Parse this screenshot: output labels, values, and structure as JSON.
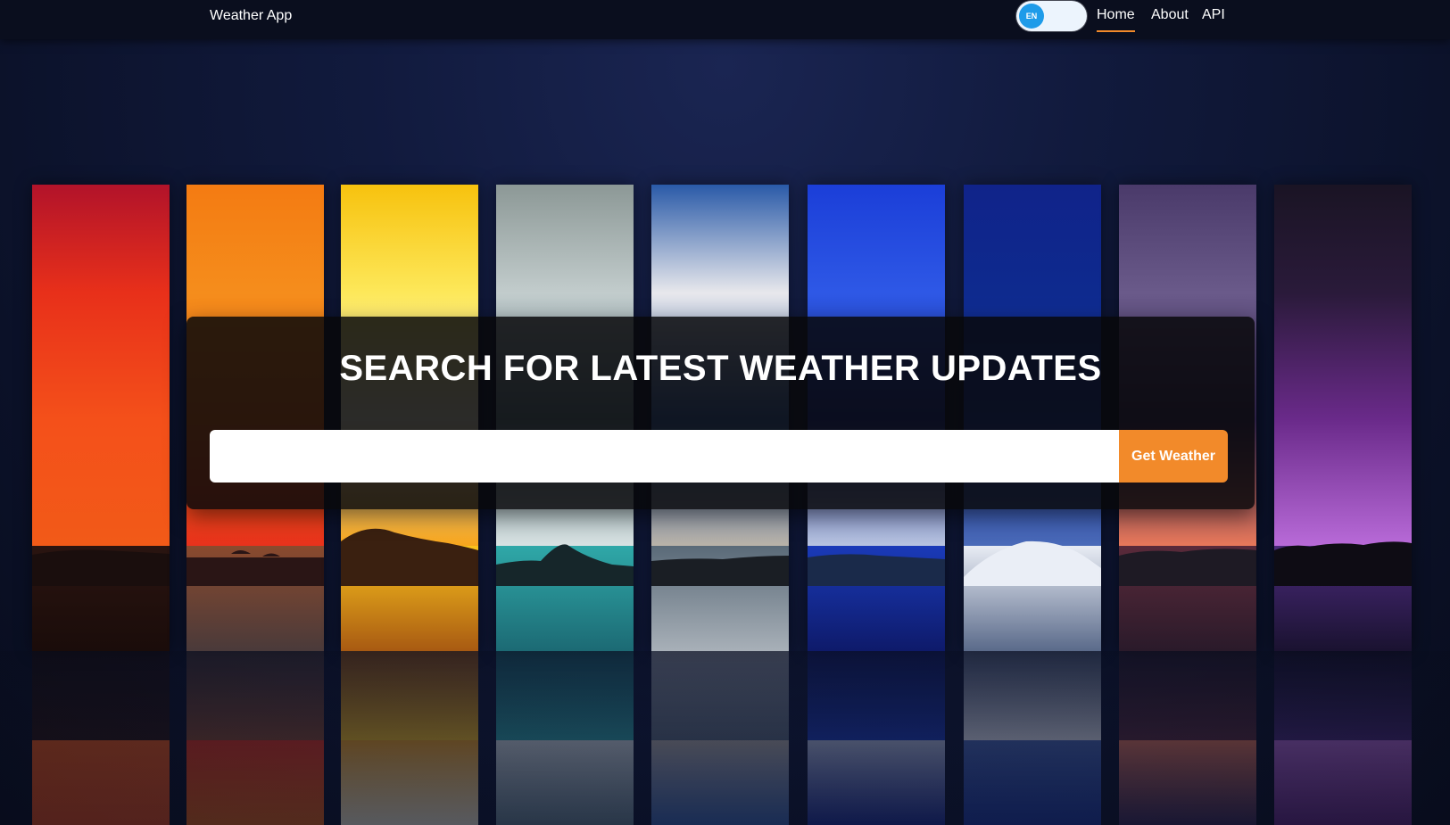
{
  "navbar": {
    "brand": "Weather App",
    "language_toggle_label": "EN",
    "links": [
      {
        "label": "Home",
        "active": true
      },
      {
        "label": "About",
        "active": false
      },
      {
        "label": "API",
        "active": false
      }
    ],
    "accent_color": "#f28a2a",
    "toggle_knob_color": "#1e9be9"
  },
  "hero": {
    "title": "SEARCH FOR LATEST WEATHER UPDATES",
    "search": {
      "value": "",
      "placeholder": "",
      "button_label": "Get Weather"
    },
    "button_color": "#f28a2a"
  },
  "background_panels": [
    {
      "name": "red-sunset",
      "sky": [
        "#b2132a",
        "#e8301a",
        "#f4501a",
        "#f25a18"
      ],
      "sea": [
        "#2a1410",
        "#1a0c0a"
      ],
      "land": "#1a0e0d"
    },
    {
      "name": "orange-sunset",
      "sky": [
        "#f47b12",
        "#f58d1c",
        "#f16a14",
        "#e8321c"
      ],
      "sea": [
        "#8a4a2e",
        "#4a3a3a"
      ],
      "land": "#2a1515"
    },
    {
      "name": "yellow-sun",
      "sky": [
        "#f7c20e",
        "#fde85a",
        "#fffbe0",
        "#f6a51c"
      ],
      "sea": [
        "#f9c21d",
        "#a85a12"
      ],
      "land": "#3a2010"
    },
    {
      "name": "cloudy-teal",
      "sky": [
        "#8c9896",
        "#c2cccc",
        "#6a8a96",
        "#d8e2e2"
      ],
      "sea": [
        "#2fa8a8",
        "#1c6a74"
      ],
      "land": "#16262a"
    },
    {
      "name": "blue-clouds",
      "sky": [
        "#2a5aa8",
        "#e8e8ec",
        "#3a6ab8",
        "#b8b2a8"
      ],
      "sea": [
        "#5a6a78",
        "#a8b0b8"
      ],
      "land": "#1a1e24"
    },
    {
      "name": "deep-blue",
      "sky": [
        "#1b3ed8",
        "#2e58e6",
        "#1a2e9a",
        "#b8c4e0"
      ],
      "sea": [
        "#1a3ab8",
        "#0e1a6a"
      ],
      "land": "#1a2a4a"
    },
    {
      "name": "navy-snow",
      "sky": [
        "#10238a",
        "#0e2a8e",
        "#1a3aa8",
        "#4a6ab8"
      ],
      "sea": [
        "#e8ecf4",
        "#5a6a8a"
      ],
      "land": "#eaeef6"
    },
    {
      "name": "purple-dusk",
      "sky": [
        "#4a3a6a",
        "#6a5a8a",
        "#3a2a5a",
        "#e8785a"
      ],
      "sea": [
        "#5a2a3a",
        "#2a1a2a"
      ],
      "land": "#1e1a24"
    },
    {
      "name": "violet-storm",
      "sky": [
        "#1a1424",
        "#2a1a3a",
        "#6a2a8a",
        "#b86ad8"
      ],
      "sea": [
        "#4a2a7a",
        "#1a1230"
      ],
      "land": "#0e0c14"
    }
  ]
}
